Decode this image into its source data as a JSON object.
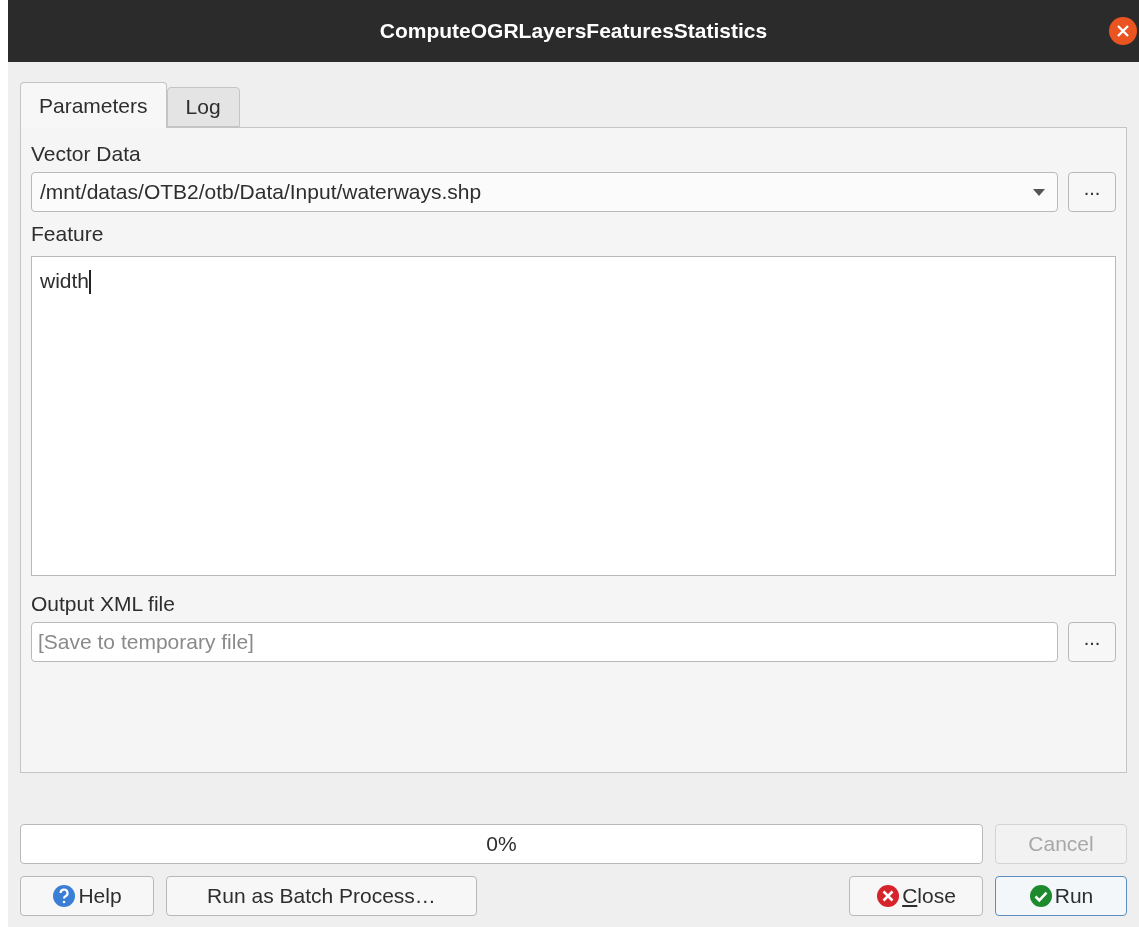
{
  "window": {
    "title": "ComputeOGRLayersFeaturesStatistics"
  },
  "tabs": [
    {
      "label": "Parameters",
      "selected": true
    },
    {
      "label": "Log",
      "selected": false
    }
  ],
  "vector_data": {
    "label": "Vector Data",
    "value": "/mnt/datas/OTB2/otb/Data/Input/waterways.shp",
    "browse": "..."
  },
  "feature": {
    "label": "Feature",
    "value": "width"
  },
  "output_xml": {
    "label": "Output XML file",
    "placeholder": "[Save to temporary file]",
    "browse": "..."
  },
  "progress": {
    "level": 0,
    "text": "0%"
  },
  "cancel": {
    "label": "Cancel",
    "disabled": true
  },
  "buttons": [
    {
      "kind": "help",
      "label": "Help"
    },
    {
      "kind": "batch",
      "label": "Run as Batch Process…"
    },
    {
      "kind": "close",
      "label": "Close",
      "mnemonic_first": true
    },
    {
      "kind": "run",
      "label": "Run",
      "default": true
    }
  ]
}
